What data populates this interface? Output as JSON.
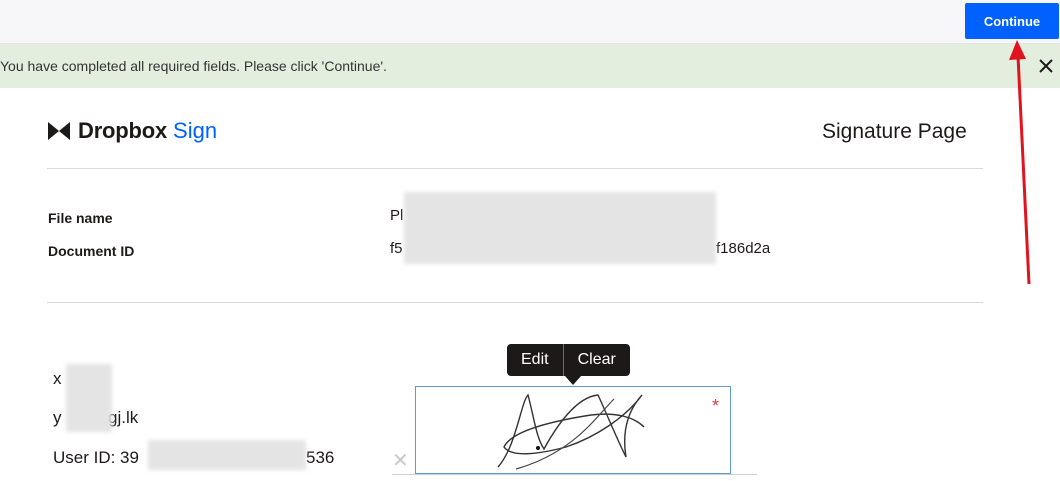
{
  "header": {
    "continue_label": "Continue"
  },
  "notice": {
    "text": "You have completed all required fields. Please click 'Continue'."
  },
  "brand": {
    "name": "Dropbox",
    "product": "Sign"
  },
  "page": {
    "heading": "Signature Page"
  },
  "meta": {
    "file_name_label": "File name",
    "file_name_value": "Pl",
    "document_id_label": "Document ID",
    "document_id_prefix": "f5",
    "document_id_suffix": "f186d2a"
  },
  "signer": {
    "name_partial": "x",
    "email_prefix": "y",
    "email_suffix": "gj.lk",
    "user_id_prefix": "User ID: 39",
    "user_id_suffix": "536"
  },
  "signature": {
    "edit_label": "Edit",
    "clear_label": "Clear",
    "required_mark": "*",
    "x_mark": "✕"
  },
  "colors": {
    "accent": "#0061fe",
    "notice_bg": "#e3eedf",
    "annotation_arrow": "#e0141e"
  },
  "icons": {
    "close": "close-icon",
    "logo": "dropbox-logo-icon",
    "arrow": "annotation-arrow-icon"
  }
}
